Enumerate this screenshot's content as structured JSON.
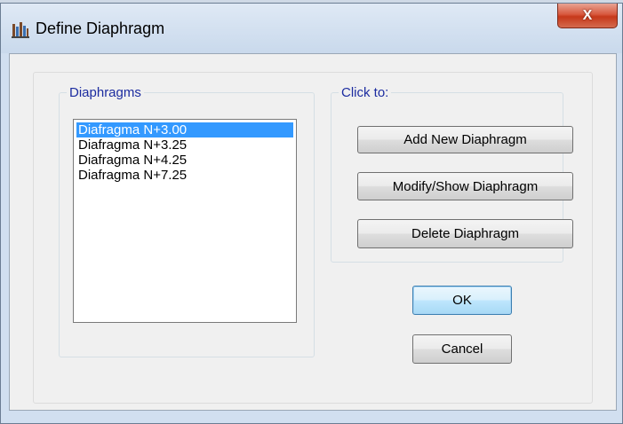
{
  "window": {
    "title": "Define Diaphragm",
    "close_label": "X"
  },
  "diaphragms_group": {
    "label": "Diaphragms",
    "items": [
      {
        "label": "Diafragma N+3.00",
        "selected": true
      },
      {
        "label": "Diafragma N+3.25",
        "selected": false
      },
      {
        "label": "Diafragma N+4.25",
        "selected": false
      },
      {
        "label": "Diafragma N+7.25",
        "selected": false
      }
    ]
  },
  "click_group": {
    "label": "Click to:",
    "add_label": "Add New Diaphragm",
    "modify_label": "Modify/Show Diaphragm",
    "delete_label": "Delete Diaphragm"
  },
  "buttons": {
    "ok_label": "OK",
    "cancel_label": "Cancel"
  },
  "colors": {
    "selection": "#3399ff",
    "group_label": "#1c2ca0",
    "window_frame": "#d1dff0",
    "close_button": "#c6381a"
  },
  "icons": {
    "app": "etabs-app-icon",
    "close": "close-icon"
  }
}
